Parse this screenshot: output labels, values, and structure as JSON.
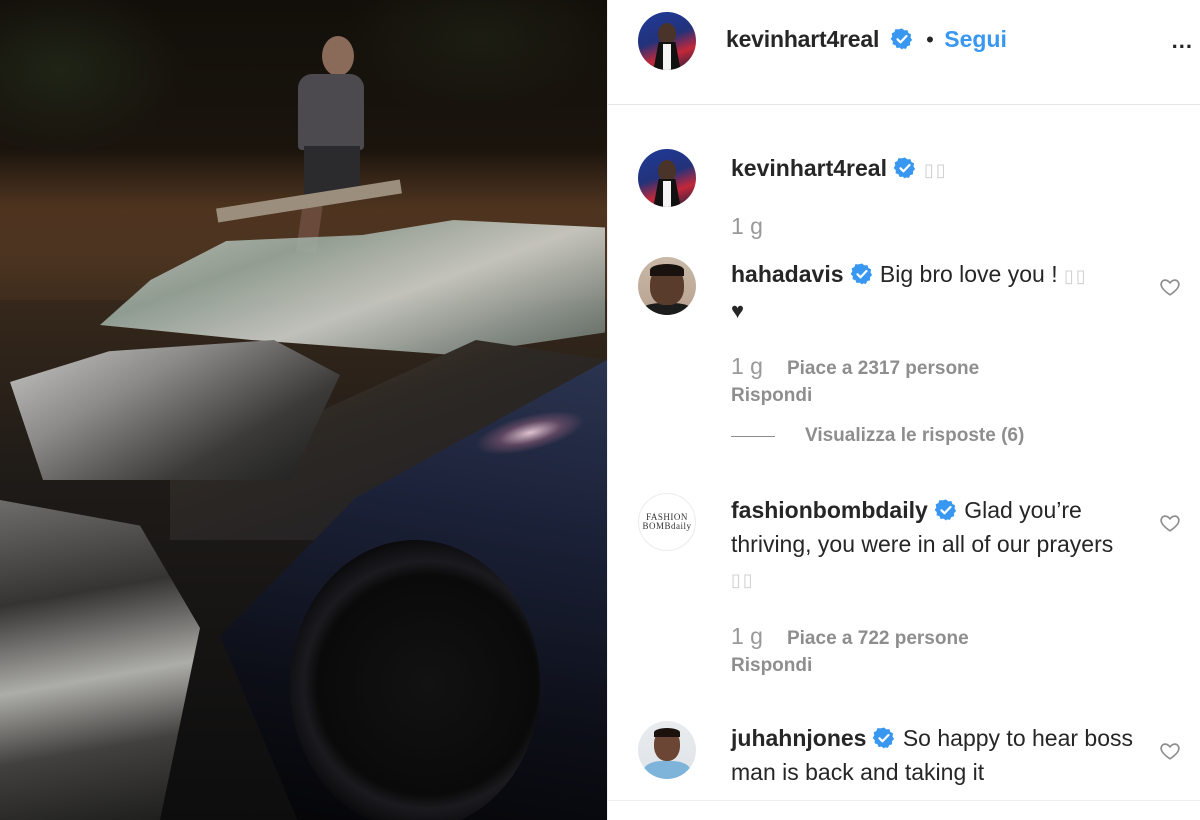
{
  "header": {
    "username": "kevinhart4real",
    "follow_label": "Segui",
    "more_label": "..."
  },
  "caption": {
    "username": "kevinhart4real",
    "text": "",
    "time": "1 g"
  },
  "comments": [
    {
      "username": "hahadavis",
      "text": "Big bro love you ! ",
      "emoji": "♥",
      "time": "1 g",
      "likes": "Piace a 2317 persone",
      "reply": "Rispondi",
      "view_replies": "Visualizza le risposte (6)"
    },
    {
      "username": "fashionbombdaily",
      "text": "Glad you’re thriving, you were in all of our prayers ",
      "time": "1 g",
      "likes": "Piace a 722 persone",
      "reply": "Rispondi",
      "avatar_logo": "FASHION\nBOMBdaily"
    },
    {
      "username": "juhahnjones",
      "text": "So happy to hear boss man is back and taking it"
    }
  ],
  "colors": {
    "link_blue": "#3897f0",
    "verified_blue": "#3897f0",
    "muted_text": "#8e8e8e"
  },
  "icons": [
    "verified-badge-icon",
    "heart-outline-icon",
    "more-options-icon"
  ]
}
